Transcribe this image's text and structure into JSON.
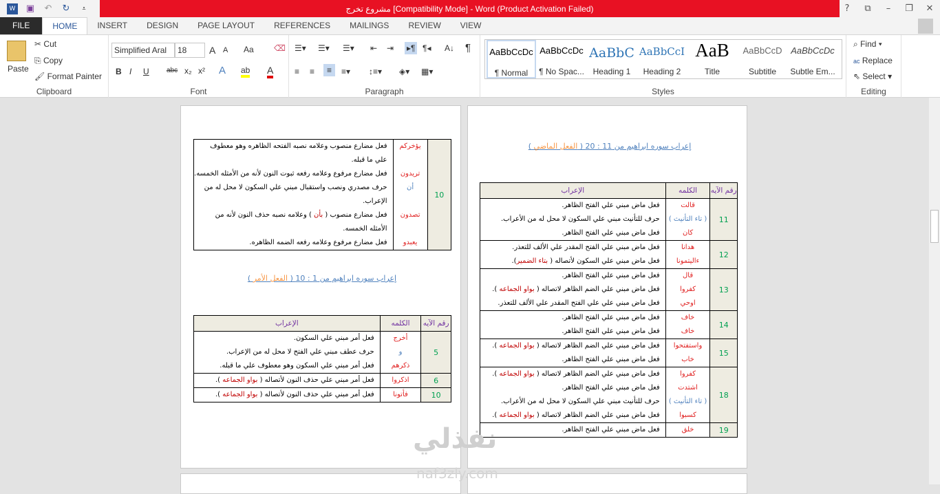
{
  "window": {
    "title": "مشروع تخرج [Compatibility Mode] -  Word (Product Activation Failed)",
    "help": "?",
    "restore_ribbon": "⧉",
    "minimize": "–",
    "maximize": "❐",
    "close": "✕"
  },
  "qat": {
    "icons": [
      "word-icon",
      "save-icon",
      "undo-icon",
      "redo-icon",
      "customize-icon"
    ]
  },
  "tabs": [
    "FILE",
    "HOME",
    "INSERT",
    "DESIGN",
    "PAGE LAYOUT",
    "REFERENCES",
    "MAILINGS",
    "REVIEW",
    "VIEW"
  ],
  "active_tab": "HOME",
  "clipboard": {
    "paste": "Paste",
    "cut": "Cut",
    "copy": "Copy",
    "format_painter": "Format Painter",
    "label": "Clipboard"
  },
  "font": {
    "name": "Simplified Aral",
    "size": "18",
    "label": "Font",
    "bold": "B",
    "italic": "I",
    "underline": "U",
    "strike": "abc",
    "sub": "x₂",
    "sup": "x²",
    "case": "Aa",
    "grow": "A",
    "shrink": "A",
    "highlight_color": "#ffff00",
    "font_color": "#e00000"
  },
  "paragraph": {
    "label": "Paragraph",
    "pilcrow": "¶"
  },
  "styles": {
    "label": "Styles",
    "items": [
      {
        "preview": "AaBbCcDc",
        "name": "¶ Normal"
      },
      {
        "preview": "AaBbCcDc",
        "name": "¶ No Spac..."
      },
      {
        "preview": "AaBbC",
        "name": "Heading 1"
      },
      {
        "preview": "AaBbCcI",
        "name": "Heading 2"
      },
      {
        "preview": "AaB",
        "name": "Title"
      },
      {
        "preview": "AaBbCcD",
        "name": "Subtitle"
      },
      {
        "preview": "AaBbCcDc",
        "name": "Subtle Em..."
      }
    ],
    "selected": "¶ Normal"
  },
  "editing": {
    "label": "Editing",
    "find": "Find",
    "replace": "Replace",
    "select": "Select"
  },
  "colors": {
    "accent_red": "#e81123",
    "word_red": "#e02020",
    "blue": "#4f81bd",
    "orange": "#f79646",
    "green": "#00a050",
    "purple": "#7030a0"
  },
  "right_page": {
    "title": {
      "main": "إعراب سوره ابراهيم من 11 : 20 ( ",
      "em": "الفعل الماضي",
      "end": " )"
    },
    "headers": [
      "رقم الآيه",
      "الكلمه",
      "الإعراب"
    ],
    "rows": [
      {
        "num": "11",
        "words": [
          {
            "t": "قالت",
            "c": "red"
          },
          {
            "t": "( تاء التأنيث )",
            "c": "blu"
          },
          {
            "t": "كان",
            "c": "red"
          }
        ],
        "desc": [
          {
            "t": "فعل ماض مبني علي الفتح الظاهر."
          },
          {
            "t": "حرف للتأنيث مبني علي السكون لا محل له من الأعراب."
          },
          {
            "t": "فعل ماض مبني علي الفتح الظاهر."
          }
        ]
      },
      {
        "num": "12",
        "words": [
          {
            "t": "هدانا",
            "c": "red"
          },
          {
            "t": "ءاليتمونا",
            "c": "red"
          }
        ],
        "desc": [
          {
            "t": "فعل ماض مبني علي الفتح المقدر علي الألف للتعذر."
          },
          {
            "t": "فعل ماض مبني علي السكون لأتصاله ( ",
            "h": "بتاء الضمير",
            "e": ")."
          }
        ]
      },
      {
        "num": "13",
        "words": [
          {
            "t": "قال",
            "c": "red"
          },
          {
            "t": "كفروا",
            "c": "red"
          },
          {
            "t": "اوحي",
            "c": "red"
          }
        ],
        "desc": [
          {
            "t": "فعل ماض مبني علي الفتح الظاهر."
          },
          {
            "t": "فعل ماض مبني علي الضم الظاهر لاتصاله ( ",
            "h": "بواو الجماعه",
            "e": " )."
          },
          {
            "t": "فعل ماض مبني علي علي الفتح المقدر علي الألف للتعذر."
          }
        ]
      },
      {
        "num": "14",
        "words": [
          {
            "t": "خاف",
            "c": "red"
          },
          {
            "t": "خاف",
            "c": "red"
          }
        ],
        "desc": [
          {
            "t": "فعل ماض مبني علي الفتح الظاهر."
          },
          {
            "t": "فعل ماض مبني علي الفتح الظاهر."
          }
        ]
      },
      {
        "num": "15",
        "words": [
          {
            "t": "واستفتحوا",
            "c": "red"
          },
          {
            "t": "خاب",
            "c": "red"
          }
        ],
        "desc": [
          {
            "t": "فعل ماض مبني علي الضم الظاهر لاتصاله ( ",
            "h": "بواو الجماعه",
            "e": " )."
          },
          {
            "t": "فعل ماض مبني علي الفتح الظاهر."
          }
        ]
      },
      {
        "num": "18",
        "words": [
          {
            "t": "كفروا",
            "c": "red"
          },
          {
            "t": "اشتدت",
            "c": "red"
          },
          {
            "t": "( تاء التأنيث )",
            "c": "blu"
          },
          {
            "t": "كسبوا",
            "c": "red"
          }
        ],
        "desc": [
          {
            "t": "فعل ماض مبني علي الضم الظاهر لاتصاله ( ",
            "h": "بواو الجماعه",
            "e": " )."
          },
          {
            "t": "فعل ماض مبني علي الفتح الظاهر."
          },
          {
            "t": "حرف للتأنيث مبني علي السكون لا محل له من الأعراب."
          },
          {
            "t": "فعل ماض مبني علي الضم الظاهر لاتصاله ( ",
            "h": "بواو الجماعه",
            "e": " )."
          }
        ]
      },
      {
        "num": "19",
        "words": [
          {
            "t": "خلق",
            "c": "red"
          }
        ],
        "desc": [
          {
            "t": "فعل ماض مبني علي الفتح الظاهر."
          }
        ]
      }
    ]
  },
  "left_page": {
    "table1": {
      "rows": [
        {
          "num": "10",
          "words": [
            {
              "t": "يؤخركم",
              "c": "red"
            },
            {
              "t": ""
            },
            {
              "t": "تريدون",
              "c": "red"
            },
            {
              "t": "أن",
              "c": "blu"
            },
            {
              "t": ""
            },
            {
              "t": "تصدون",
              "c": "red"
            },
            {
              "t": ""
            },
            {
              "t": "يعبدو",
              "c": "red"
            }
          ],
          "desc": [
            {
              "t": "فعل مضارع منصوب وعلامه نصبه الفتحه الظاهره وهو معطوف"
            },
            {
              "t": "علي ما قبله."
            },
            {
              "t": "فعل مضارع مرفوع وعلامه رفعه ثبوت النون لأنه من الأمثله الخمسه."
            },
            {
              "t": "حرف مصدري ونصب واستقبال مبني علي السكون لا محل له من"
            },
            {
              "t": "الإعراب."
            },
            {
              "t": "فعل مضارع منصوب ( ",
              "h": "بأن",
              "e": " ) وعلامه نصبه حذف النون لأنه من"
            },
            {
              "t": "الأمثله الخمسه."
            },
            {
              "t": "فعل مضارع مرفوع وعلامه رفعه الضمه الظاهره."
            }
          ]
        }
      ]
    },
    "title": {
      "main": "إعراب سوره ابراهيم من 1 : 10 ( ",
      "em": "الفعل الأمر",
      "end": " )"
    },
    "table2": {
      "headers": [
        "رقم الآيه",
        "الكلمه",
        "الإعراب"
      ],
      "rows": [
        {
          "num": "5",
          "words": [
            {
              "t": "أخرج",
              "c": "red"
            },
            {
              "t": "و",
              "c": "blu"
            },
            {
              "t": "ذكرهم",
              "c": "red"
            }
          ],
          "desc": [
            {
              "t": "فعل أمر مبني علي السكون."
            },
            {
              "t": "حرف عطف مبني علي الفتح لا محل له من الإعراب."
            },
            {
              "t": "فعل أمر مبني علي السكون وهو معطوف علي ما قبله."
            }
          ]
        },
        {
          "num": "6",
          "words": [
            {
              "t": "اذكروا",
              "c": "red"
            }
          ],
          "desc": [
            {
              "t": "فعل أمر مبني علي حذف النون لأتصاله ( ",
              "h": "بواو الجماعه",
              "e": " )."
            }
          ]
        },
        {
          "num": "10",
          "words": [
            {
              "t": "فأتونا",
              "c": "red"
            }
          ],
          "desc": [
            {
              "t": "فعل أمر مبني علي حذف النون لأتصاله ( ",
              "h": "بواو الجماعه",
              "e": " )."
            }
          ]
        }
      ]
    }
  },
  "watermark": {
    "logo": "نفذلي",
    "url": "naf3zly.com"
  }
}
